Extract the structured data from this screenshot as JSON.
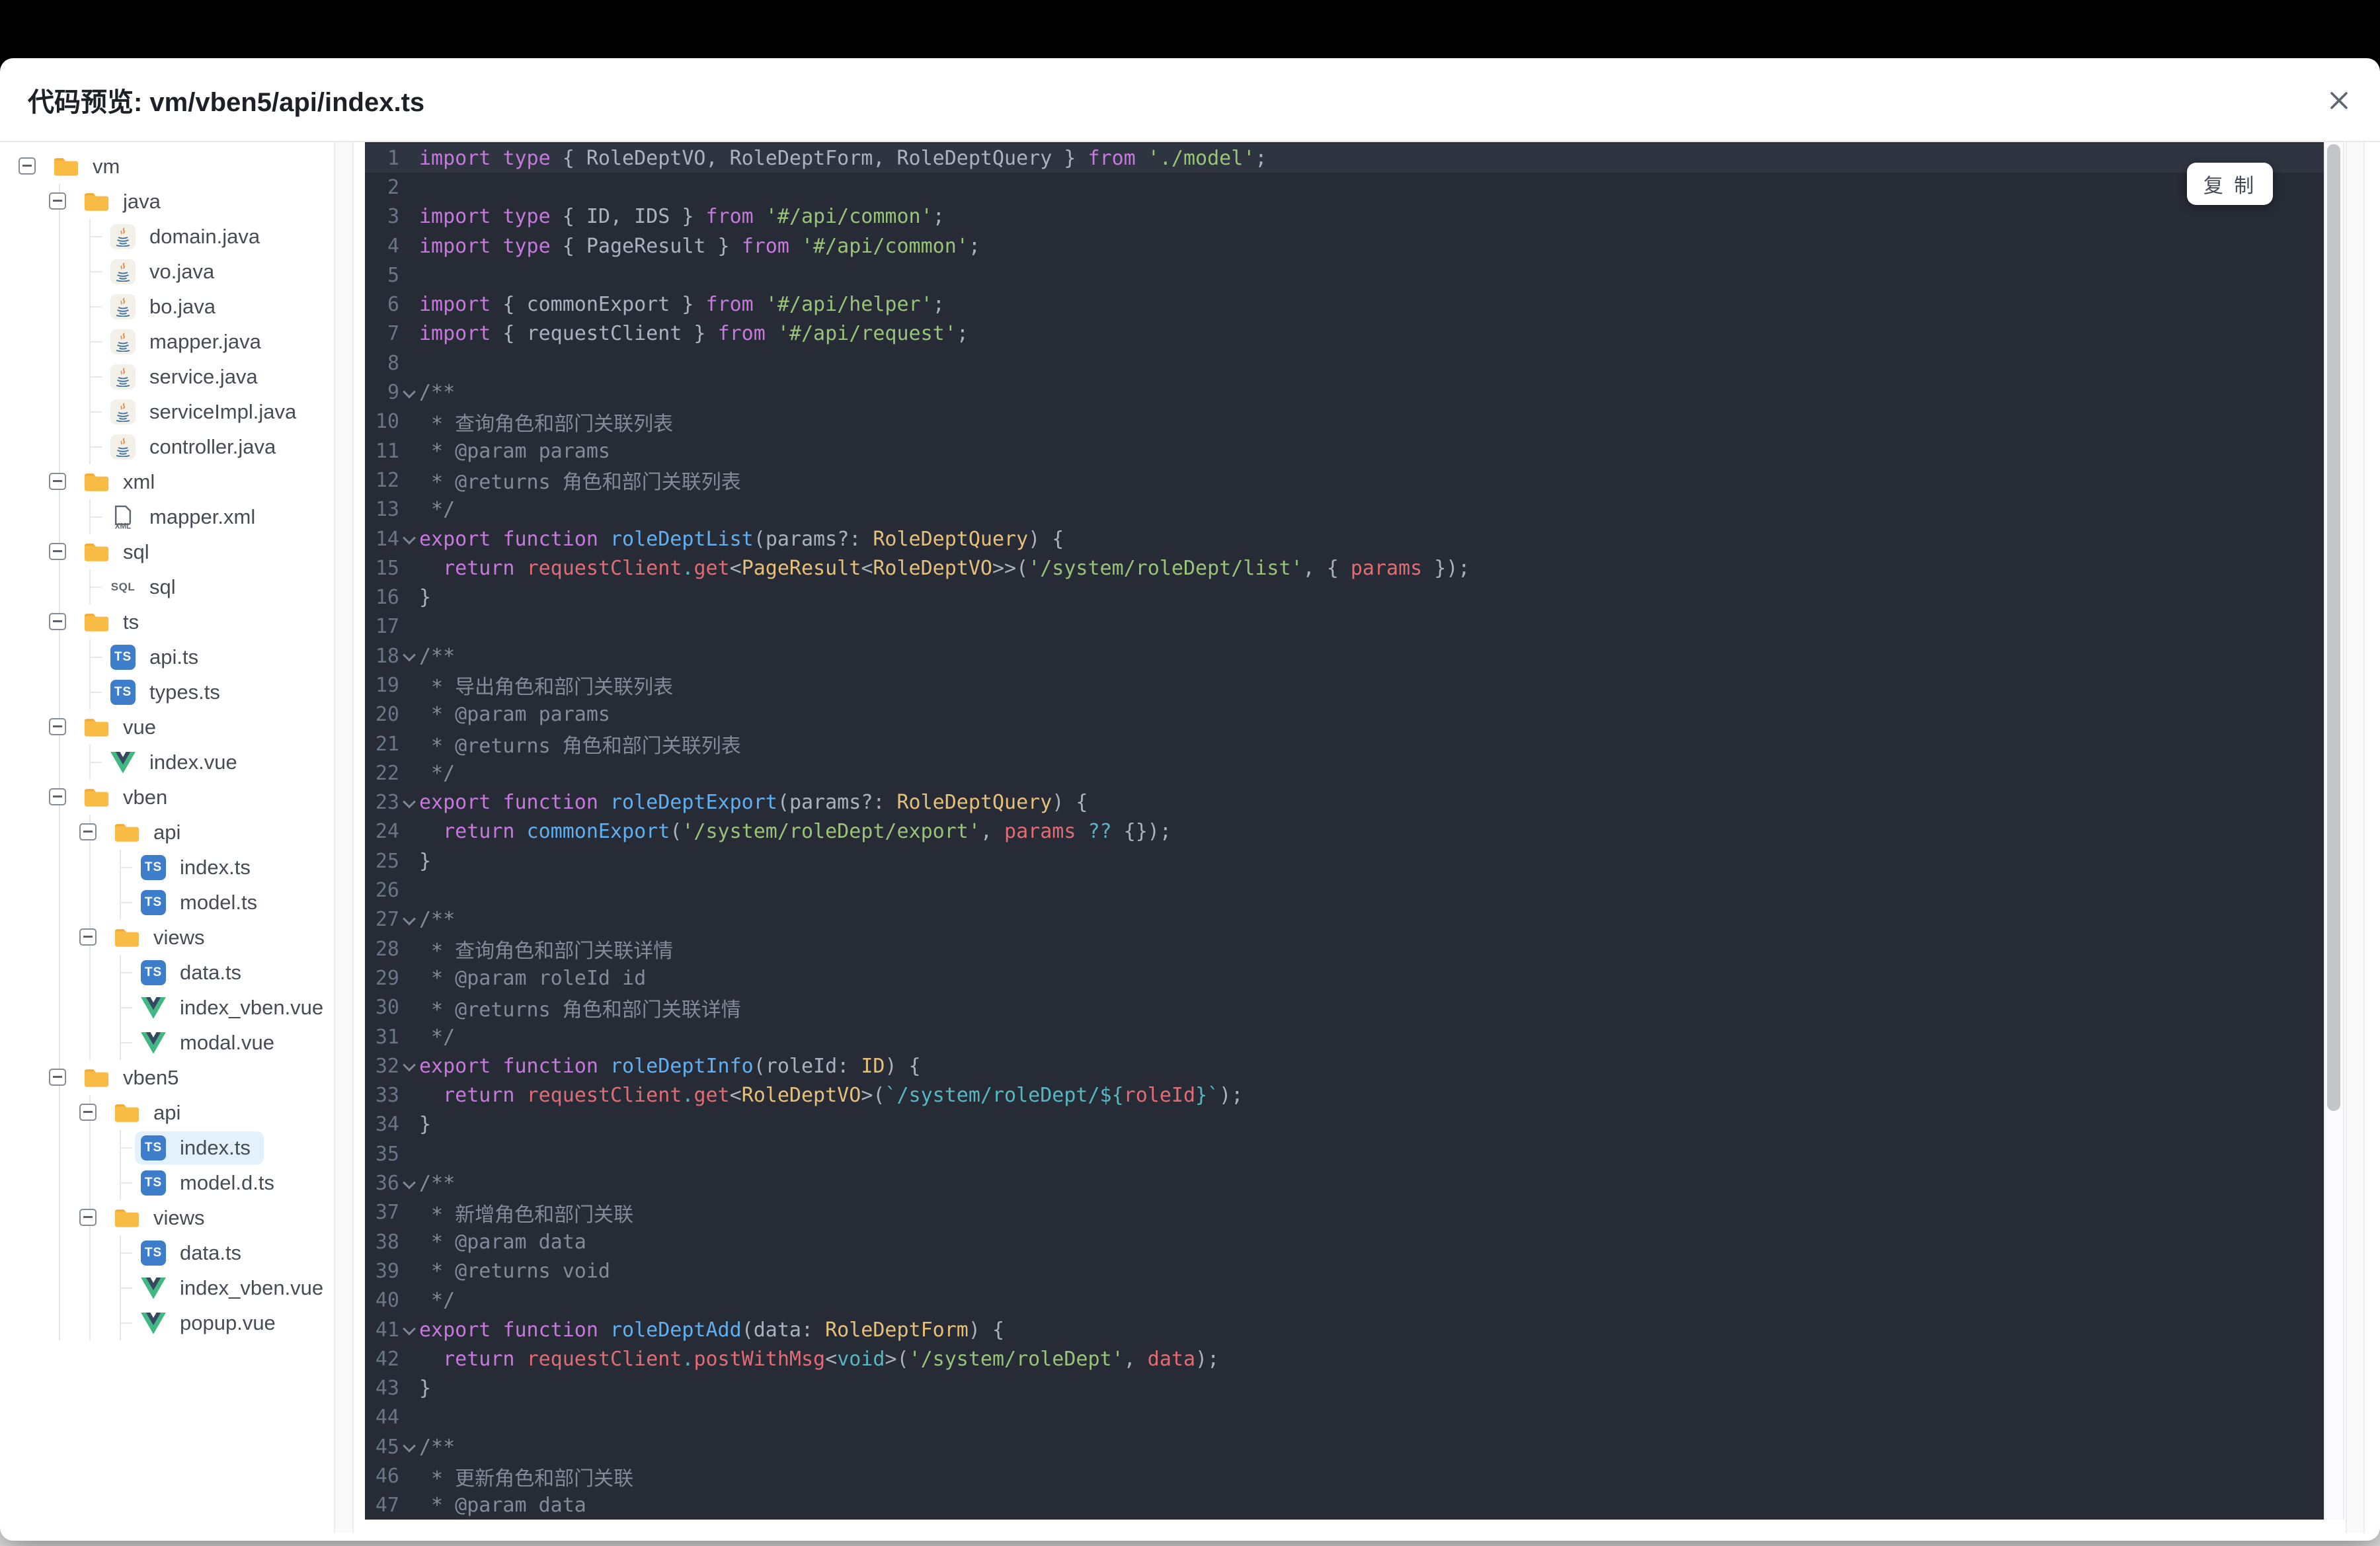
{
  "window": {
    "title": "代码预览: vm/vben5/api/index.ts"
  },
  "palette": {
    "codeBg": "#262b35",
    "codeHl": "#2e3440",
    "gutter": "#6a7586",
    "kw": "#c678dd",
    "fn": "#61afef",
    "vr": "#e06c75",
    "ty": "#e5c07b",
    "st": "#98c379",
    "tm": "#56b6c2",
    "cy": "#56b6c2",
    "pu": "#abb2bf",
    "t": "#abb2bf",
    "cm": "#848b98",
    "selBg": "#e3f1fd",
    "tsBlue": "#3d7dc9",
    "folder": "#f8bc45",
    "vueGreen": "#41b883",
    "vueDark": "#35495e"
  },
  "tree": {
    "items": [
      {
        "label": "vm",
        "depth": 0,
        "icon": "folder",
        "toggle": true
      },
      {
        "label": "java",
        "depth": 1,
        "icon": "folder",
        "toggle": true
      },
      {
        "label": "domain.java",
        "depth": 2,
        "icon": "java"
      },
      {
        "label": "vo.java",
        "depth": 2,
        "icon": "java"
      },
      {
        "label": "bo.java",
        "depth": 2,
        "icon": "java"
      },
      {
        "label": "mapper.java",
        "depth": 2,
        "icon": "java"
      },
      {
        "label": "service.java",
        "depth": 2,
        "icon": "java"
      },
      {
        "label": "serviceImpl.java",
        "depth": 2,
        "icon": "java"
      },
      {
        "label": "controller.java",
        "depth": 2,
        "icon": "java"
      },
      {
        "label": "xml",
        "depth": 1,
        "icon": "folder",
        "toggle": true
      },
      {
        "label": "mapper.xml",
        "depth": 2,
        "icon": "xml"
      },
      {
        "label": "sql",
        "depth": 1,
        "icon": "folder",
        "toggle": true
      },
      {
        "label": "sql",
        "depth": 2,
        "icon": "sql"
      },
      {
        "label": "ts",
        "depth": 1,
        "icon": "folder",
        "toggle": true
      },
      {
        "label": "api.ts",
        "depth": 2,
        "icon": "ts"
      },
      {
        "label": "types.ts",
        "depth": 2,
        "icon": "ts"
      },
      {
        "label": "vue",
        "depth": 1,
        "icon": "folder",
        "toggle": true
      },
      {
        "label": "index.vue",
        "depth": 2,
        "icon": "vue"
      },
      {
        "label": "vben",
        "depth": 1,
        "icon": "folder",
        "toggle": true
      },
      {
        "label": "api",
        "depth": 2,
        "icon": "folder",
        "toggle": true
      },
      {
        "label": "index.ts",
        "depth": 3,
        "icon": "ts"
      },
      {
        "label": "model.ts",
        "depth": 3,
        "icon": "ts"
      },
      {
        "label": "views",
        "depth": 2,
        "icon": "folder",
        "toggle": true
      },
      {
        "label": "data.ts",
        "depth": 3,
        "icon": "ts"
      },
      {
        "label": "index_vben.vue",
        "depth": 3,
        "icon": "vue"
      },
      {
        "label": "modal.vue",
        "depth": 3,
        "icon": "vue"
      },
      {
        "label": "vben5",
        "depth": 1,
        "icon": "folder",
        "toggle": true
      },
      {
        "label": "api",
        "depth": 2,
        "icon": "folder",
        "toggle": true
      },
      {
        "label": "index.ts",
        "depth": 3,
        "icon": "ts",
        "selected": true
      },
      {
        "label": "model.d.ts",
        "depth": 3,
        "icon": "ts"
      },
      {
        "label": "views",
        "depth": 2,
        "icon": "folder",
        "toggle": true
      },
      {
        "label": "data.ts",
        "depth": 3,
        "icon": "ts"
      },
      {
        "label": "index_vben.vue",
        "depth": 3,
        "icon": "vue"
      },
      {
        "label": "popup.vue",
        "depth": 3,
        "icon": "vue"
      }
    ]
  },
  "code": {
    "copy_label": "复 制",
    "lines": [
      {
        "n": 1,
        "hl": true,
        "t": [
          [
            "k",
            "import"
          ],
          [
            "t",
            " "
          ],
          [
            "k",
            "type"
          ],
          [
            "p",
            " { "
          ],
          [
            "t",
            "RoleDeptVO"
          ],
          [
            "p",
            ", "
          ],
          [
            "t",
            "RoleDeptForm"
          ],
          [
            "p",
            ", "
          ],
          [
            "t",
            "RoleDeptQuery"
          ],
          [
            "p",
            " } "
          ],
          [
            "k",
            "from"
          ],
          [
            "t",
            " "
          ],
          [
            "s",
            "'./model'"
          ],
          [
            "p",
            ";"
          ]
        ]
      },
      {
        "n": 2,
        "t": []
      },
      {
        "n": 3,
        "t": [
          [
            "k",
            "import"
          ],
          [
            "t",
            " "
          ],
          [
            "k",
            "type"
          ],
          [
            "p",
            " { "
          ],
          [
            "t",
            "ID"
          ],
          [
            "p",
            ", "
          ],
          [
            "t",
            "IDS"
          ],
          [
            "p",
            " } "
          ],
          [
            "k",
            "from"
          ],
          [
            "t",
            " "
          ],
          [
            "s",
            "'#/api/common'"
          ],
          [
            "p",
            ";"
          ]
        ]
      },
      {
        "n": 4,
        "t": [
          [
            "k",
            "import"
          ],
          [
            "t",
            " "
          ],
          [
            "k",
            "type"
          ],
          [
            "p",
            " { "
          ],
          [
            "t",
            "PageResult"
          ],
          [
            "p",
            " } "
          ],
          [
            "k",
            "from"
          ],
          [
            "t",
            " "
          ],
          [
            "s",
            "'#/api/common'"
          ],
          [
            "p",
            ";"
          ]
        ]
      },
      {
        "n": 5,
        "t": []
      },
      {
        "n": 6,
        "t": [
          [
            "k",
            "import"
          ],
          [
            "p",
            " { "
          ],
          [
            "t",
            "commonExport"
          ],
          [
            "p",
            " } "
          ],
          [
            "k",
            "from"
          ],
          [
            "t",
            " "
          ],
          [
            "s",
            "'#/api/helper'"
          ],
          [
            "p",
            ";"
          ]
        ]
      },
      {
        "n": 7,
        "t": [
          [
            "k",
            "import"
          ],
          [
            "p",
            " { "
          ],
          [
            "t",
            "requestClient"
          ],
          [
            "p",
            " } "
          ],
          [
            "k",
            "from"
          ],
          [
            "t",
            " "
          ],
          [
            "s",
            "'#/api/request'"
          ],
          [
            "p",
            ";"
          ]
        ]
      },
      {
        "n": 8,
        "t": []
      },
      {
        "n": 9,
        "f": 1,
        "t": [
          [
            "g",
            "/**"
          ]
        ]
      },
      {
        "n": 10,
        "t": [
          [
            "g",
            " * 查询角色和部门关联列表"
          ]
        ]
      },
      {
        "n": 11,
        "t": [
          [
            "g",
            " * @param params"
          ]
        ]
      },
      {
        "n": 12,
        "t": [
          [
            "g",
            " * @returns 角色和部门关联列表"
          ]
        ]
      },
      {
        "n": 13,
        "t": [
          [
            "g",
            " */"
          ]
        ]
      },
      {
        "n": 14,
        "f": 1,
        "t": [
          [
            "k",
            "export"
          ],
          [
            "t",
            " "
          ],
          [
            "k",
            "function"
          ],
          [
            "t",
            " "
          ],
          [
            "f",
            "roleDeptList"
          ],
          [
            "p",
            "("
          ],
          [
            "t",
            "params"
          ],
          [
            "p",
            "?: "
          ],
          [
            "y",
            "RoleDeptQuery"
          ],
          [
            "p",
            ") {"
          ]
        ]
      },
      {
        "n": 15,
        "t": [
          [
            "t",
            "  "
          ],
          [
            "k",
            "return"
          ],
          [
            "t",
            " "
          ],
          [
            "v",
            "requestClient"
          ],
          [
            "c",
            "."
          ],
          [
            "v",
            "get"
          ],
          [
            "p",
            "<"
          ],
          [
            "y",
            "PageResult"
          ],
          [
            "p",
            "<"
          ],
          [
            "y",
            "RoleDeptVO"
          ],
          [
            "p",
            ">>("
          ],
          [
            "s",
            "'/system/roleDept/list'"
          ],
          [
            "p",
            ", { "
          ],
          [
            "v",
            "params"
          ],
          [
            "p",
            " });"
          ]
        ]
      },
      {
        "n": 16,
        "t": [
          [
            "p",
            "}"
          ]
        ]
      },
      {
        "n": 17,
        "t": []
      },
      {
        "n": 18,
        "f": 1,
        "t": [
          [
            "g",
            "/**"
          ]
        ]
      },
      {
        "n": 19,
        "t": [
          [
            "g",
            " * 导出角色和部门关联列表"
          ]
        ]
      },
      {
        "n": 20,
        "t": [
          [
            "g",
            " * @param params"
          ]
        ]
      },
      {
        "n": 21,
        "t": [
          [
            "g",
            " * @returns 角色和部门关联列表"
          ]
        ]
      },
      {
        "n": 22,
        "t": [
          [
            "g",
            " */"
          ]
        ]
      },
      {
        "n": 23,
        "f": 1,
        "t": [
          [
            "k",
            "export"
          ],
          [
            "t",
            " "
          ],
          [
            "k",
            "function"
          ],
          [
            "t",
            " "
          ],
          [
            "f",
            "roleDeptExport"
          ],
          [
            "p",
            "("
          ],
          [
            "t",
            "params"
          ],
          [
            "p",
            "?: "
          ],
          [
            "y",
            "RoleDeptQuery"
          ],
          [
            "p",
            ") {"
          ]
        ]
      },
      {
        "n": 24,
        "t": [
          [
            "t",
            "  "
          ],
          [
            "k",
            "return"
          ],
          [
            "t",
            " "
          ],
          [
            "f",
            "commonExport"
          ],
          [
            "p",
            "("
          ],
          [
            "s",
            "'/system/roleDept/export'"
          ],
          [
            "p",
            ", "
          ],
          [
            "v",
            "params"
          ],
          [
            "t",
            " "
          ],
          [
            "c",
            "??"
          ],
          [
            "p",
            " {});"
          ]
        ]
      },
      {
        "n": 25,
        "t": [
          [
            "p",
            "}"
          ]
        ]
      },
      {
        "n": 26,
        "t": []
      },
      {
        "n": 27,
        "f": 1,
        "t": [
          [
            "g",
            "/**"
          ]
        ]
      },
      {
        "n": 28,
        "t": [
          [
            "g",
            " * 查询角色和部门关联详情"
          ]
        ]
      },
      {
        "n": 29,
        "t": [
          [
            "g",
            " * @param roleId id"
          ]
        ]
      },
      {
        "n": 30,
        "t": [
          [
            "g",
            " * @returns 角色和部门关联详情"
          ]
        ]
      },
      {
        "n": 31,
        "t": [
          [
            "g",
            " */"
          ]
        ]
      },
      {
        "n": 32,
        "f": 1,
        "t": [
          [
            "k",
            "export"
          ],
          [
            "t",
            " "
          ],
          [
            "k",
            "function"
          ],
          [
            "t",
            " "
          ],
          [
            "f",
            "roleDeptInfo"
          ],
          [
            "p",
            "("
          ],
          [
            "t",
            "roleId"
          ],
          [
            "p",
            ": "
          ],
          [
            "y",
            "ID"
          ],
          [
            "p",
            ") {"
          ]
        ]
      },
      {
        "n": 33,
        "t": [
          [
            "t",
            "  "
          ],
          [
            "k",
            "return"
          ],
          [
            "t",
            " "
          ],
          [
            "v",
            "requestClient"
          ],
          [
            "c",
            "."
          ],
          [
            "v",
            "get"
          ],
          [
            "p",
            "<"
          ],
          [
            "y",
            "RoleDeptVO"
          ],
          [
            "p",
            ">("
          ],
          [
            "m",
            "`/system/roleDept/"
          ],
          [
            "c",
            "${"
          ],
          [
            "v",
            "roleId"
          ],
          [
            "c",
            "}"
          ],
          [
            "m",
            "`"
          ],
          [
            "p",
            ");"
          ]
        ]
      },
      {
        "n": 34,
        "t": [
          [
            "p",
            "}"
          ]
        ]
      },
      {
        "n": 35,
        "t": []
      },
      {
        "n": 36,
        "f": 1,
        "t": [
          [
            "g",
            "/**"
          ]
        ]
      },
      {
        "n": 37,
        "t": [
          [
            "g",
            " * 新增角色和部门关联"
          ]
        ]
      },
      {
        "n": 38,
        "t": [
          [
            "g",
            " * @param data"
          ]
        ]
      },
      {
        "n": 39,
        "t": [
          [
            "g",
            " * @returns void"
          ]
        ]
      },
      {
        "n": 40,
        "t": [
          [
            "g",
            " */"
          ]
        ]
      },
      {
        "n": 41,
        "f": 1,
        "t": [
          [
            "k",
            "export"
          ],
          [
            "t",
            " "
          ],
          [
            "k",
            "function"
          ],
          [
            "t",
            " "
          ],
          [
            "f",
            "roleDeptAdd"
          ],
          [
            "p",
            "("
          ],
          [
            "t",
            "data"
          ],
          [
            "p",
            ": "
          ],
          [
            "y",
            "RoleDeptForm"
          ],
          [
            "p",
            ") {"
          ]
        ]
      },
      {
        "n": 42,
        "t": [
          [
            "t",
            "  "
          ],
          [
            "k",
            "return"
          ],
          [
            "t",
            " "
          ],
          [
            "v",
            "requestClient"
          ],
          [
            "c",
            "."
          ],
          [
            "v",
            "postWithMsg"
          ],
          [
            "p",
            "<"
          ],
          [
            "c",
            "void"
          ],
          [
            "p",
            ">("
          ],
          [
            "s",
            "'/system/roleDept'"
          ],
          [
            "p",
            ", "
          ],
          [
            "v",
            "data"
          ],
          [
            "p",
            ");"
          ]
        ]
      },
      {
        "n": 43,
        "t": [
          [
            "p",
            "}"
          ]
        ]
      },
      {
        "n": 44,
        "t": []
      },
      {
        "n": 45,
        "f": 1,
        "t": [
          [
            "g",
            "/**"
          ]
        ]
      },
      {
        "n": 46,
        "t": [
          [
            "g",
            " * 更新角色和部门关联"
          ]
        ]
      },
      {
        "n": 47,
        "t": [
          [
            "g",
            " * @param data"
          ]
        ]
      }
    ]
  }
}
